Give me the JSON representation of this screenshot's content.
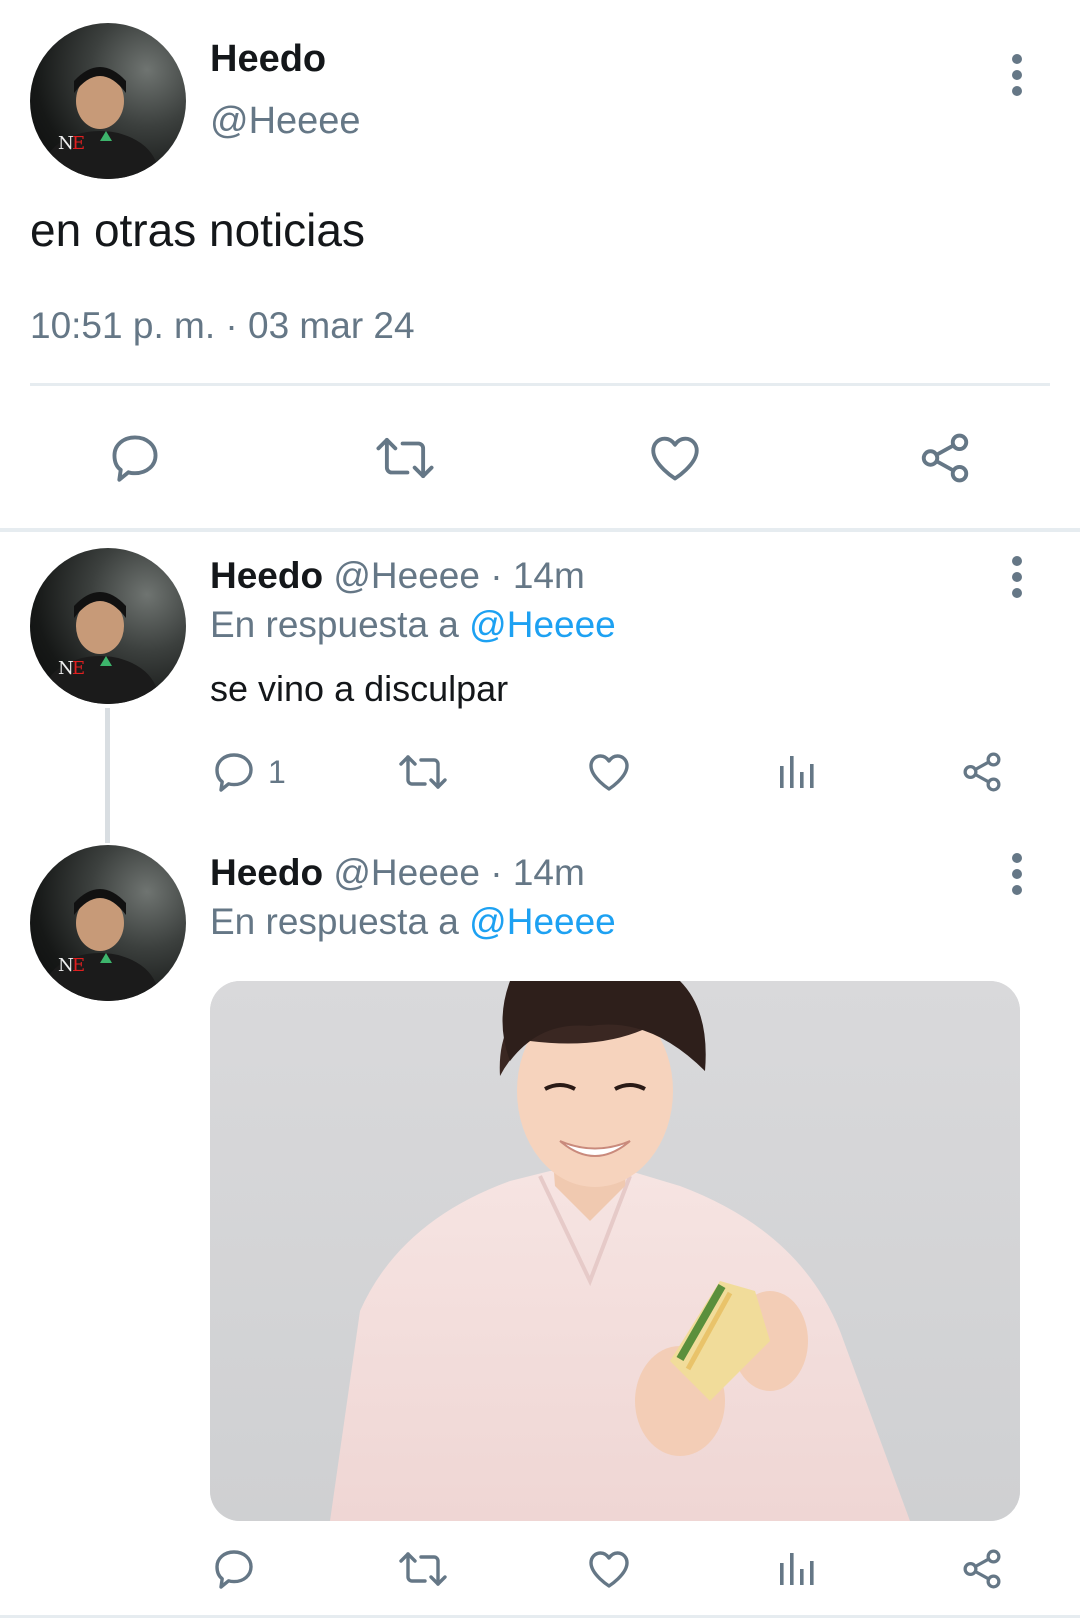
{
  "main_tweet": {
    "display_name": "Heedo",
    "handle": "@Heeee",
    "text": "en otras noticias",
    "timestamp": "10:51 p. m. · 03 mar 24",
    "icons": [
      "reply-icon",
      "retweet-icon",
      "like-icon",
      "share-icon",
      "more-icon"
    ]
  },
  "replies": [
    {
      "display_name": "Heedo",
      "handle": "@Heeee",
      "time": "· 14m",
      "reply_prefix": "En respuesta a",
      "reply_mention": "@Heeee",
      "text": "se vino a disculpar",
      "reply_count": "1",
      "icons": [
        "reply-icon",
        "retweet-icon",
        "like-icon",
        "analytics-icon",
        "share-icon"
      ]
    },
    {
      "display_name": "Heedo",
      "handle": "@Heeee",
      "time": "· 14m",
      "reply_prefix": "En respuesta a",
      "reply_mention": "@Heeee",
      "media": "photo",
      "icons": [
        "reply-icon",
        "retweet-icon",
        "like-icon",
        "analytics-icon",
        "share-icon"
      ]
    }
  ],
  "colors": {
    "text": "#14171a",
    "secondary": "#657786",
    "link": "#1da1f2",
    "icon": "#657786",
    "divider": "#e6ecf0"
  }
}
